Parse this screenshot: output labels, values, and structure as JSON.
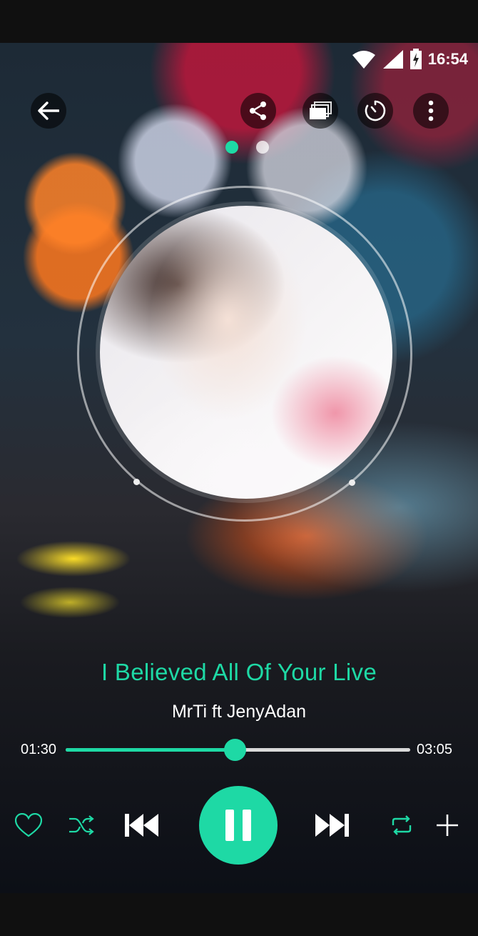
{
  "status_bar": {
    "time": "16:54",
    "icons": [
      "wifi-icon",
      "signal-icon",
      "battery-charging-icon"
    ]
  },
  "toolbar": {
    "icons": [
      "back-arrow-icon",
      "share-icon",
      "queue-icon",
      "sleep-timer-icon",
      "more-vertical-icon"
    ]
  },
  "pager": {
    "page_count": 2,
    "active_index": 0
  },
  "song": {
    "title": "I Believed All Of Your Live",
    "artist": "MrTi ft JenyAdan"
  },
  "playback": {
    "elapsed": "01:30",
    "duration": "03:05",
    "progress_fraction": 0.49,
    "state": "playing"
  },
  "controls": {
    "icons": [
      "heart-icon",
      "shuffle-icon",
      "previous-icon",
      "pause-icon",
      "next-icon",
      "repeat-icon",
      "add-icon"
    ]
  },
  "colors": {
    "accent": "#1ed9a5",
    "text": "#ffffff"
  }
}
